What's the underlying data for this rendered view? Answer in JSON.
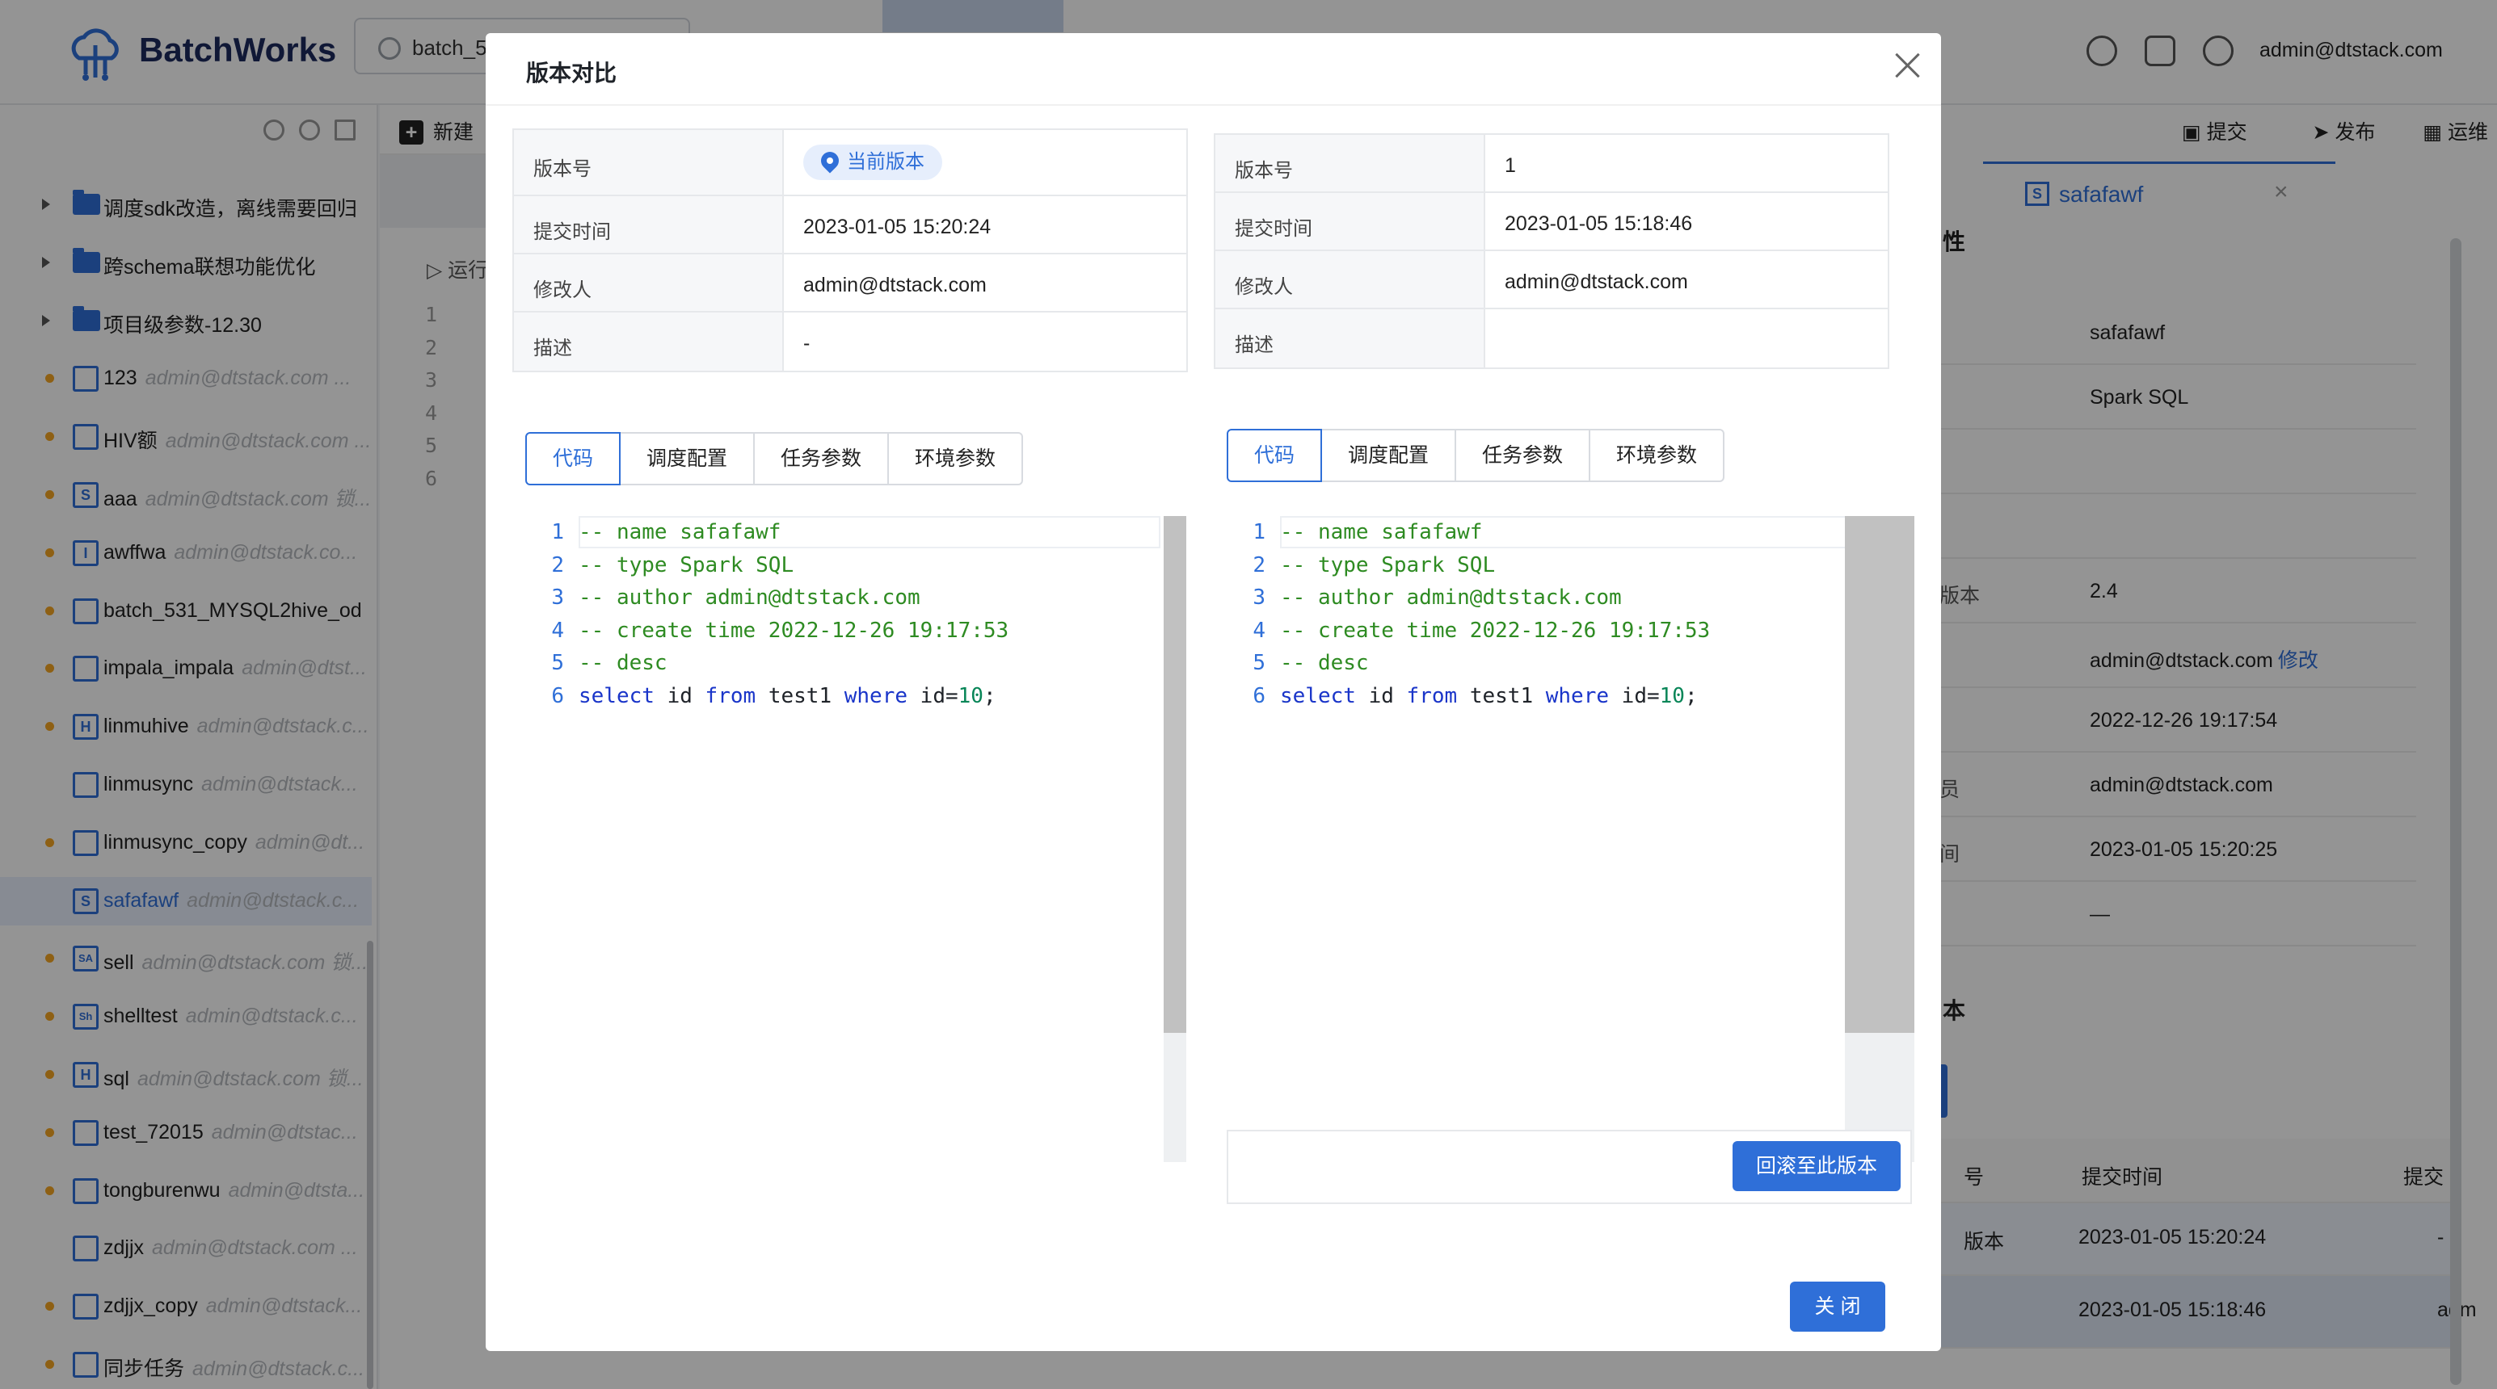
{
  "app": {
    "brand": "BatchWorks",
    "open_tab": "batch_5",
    "user": "admin@dtstack.com",
    "accent_color": "#2f6fd8"
  },
  "header_icons": [
    "help-icon",
    "message-icon",
    "settings-icon"
  ],
  "toolbar": {
    "new_label": "新建",
    "submit_label": "提交",
    "publish_label": "发布",
    "ops_label": "运维"
  },
  "sidebar": {
    "items": [
      {
        "type": "folder",
        "name": "调度sdk改造，离线需要回归",
        "owner": ""
      },
      {
        "type": "folder",
        "name": "跨schema联想功能优化",
        "owner": ""
      },
      {
        "type": "folder",
        "name": "项目级参数-12.30",
        "owner": ""
      },
      {
        "type": "task",
        "icon": "sync-task-icon",
        "badge": "",
        "name": "123",
        "owner": "admin@dtstack.com ..."
      },
      {
        "type": "task",
        "icon": "sync-task-icon",
        "badge": "",
        "name": "HIV额",
        "owner": "admin@dtstack.com ..."
      },
      {
        "type": "task",
        "icon": "spark-sql-icon",
        "badge": "S",
        "name": "aaa",
        "owner": "admin@dtstack.com 锁..."
      },
      {
        "type": "task",
        "icon": "impala-icon",
        "badge": "I",
        "name": "awffwa",
        "owner": "admin@dtstack.co..."
      },
      {
        "type": "task",
        "icon": "sync-task-icon",
        "badge": "",
        "name": "batch_531_MYSQL2hive_od",
        "owner": ""
      },
      {
        "type": "task",
        "icon": "sync-task-icon",
        "badge": "",
        "name": "impala_impala",
        "owner": "admin@dtst..."
      },
      {
        "type": "task",
        "icon": "hive-sql-icon",
        "badge": "H",
        "name": "linmuhive",
        "owner": "admin@dtstack.c..."
      },
      {
        "type": "task",
        "icon": "sync-task-icon",
        "badge": "",
        "name": "linmusync",
        "owner": "admin@dtstack..."
      },
      {
        "type": "task",
        "icon": "sync-task-icon",
        "badge": "",
        "name": "linmusync_copy",
        "owner": "admin@dt..."
      },
      {
        "type": "task",
        "icon": "spark-sql-icon",
        "badge": "S",
        "name": "safafawf",
        "owner": "admin@dtstack.c...",
        "selected": true
      },
      {
        "type": "task",
        "icon": "spark-icon",
        "badge": "SA",
        "name": "sell",
        "owner": "admin@dtstack.com 锁..."
      },
      {
        "type": "task",
        "icon": "shell-icon",
        "badge": "Sh",
        "name": "shelltest",
        "owner": "admin@dtstack.c..."
      },
      {
        "type": "task",
        "icon": "hive-sql-icon",
        "badge": "H",
        "name": "sql",
        "owner": "admin@dtstack.com 锁..."
      },
      {
        "type": "task",
        "icon": "sync-task-icon",
        "badge": "",
        "name": "test_72015",
        "owner": "admin@dtstac..."
      },
      {
        "type": "task",
        "icon": "sync-task-icon",
        "badge": "",
        "name": "tongburenwu",
        "owner": "admin@dtsta..."
      },
      {
        "type": "task",
        "icon": "sync-task-icon",
        "badge": "",
        "name": "zdjjx",
        "owner": "admin@dtstack.com ..."
      },
      {
        "type": "task",
        "icon": "sync-task-icon",
        "badge": "",
        "name": "zdjjx_copy",
        "owner": "admin@dtstack..."
      },
      {
        "type": "task",
        "icon": "sync-task-icon",
        "badge": "",
        "name": "同步任务",
        "owner": "admin@dtstack.c..."
      }
    ]
  },
  "editor": {
    "run_label": "运行",
    "gutter": [
      "1",
      "2",
      "3",
      "4",
      "5",
      "6"
    ]
  },
  "right_panel": {
    "tab_label": "safafawf",
    "tab_badge": "S",
    "section_title": "性",
    "props": [
      {
        "k": "",
        "v": "safafawf"
      },
      {
        "k": "",
        "v": "Spark SQL"
      },
      {
        "k": "",
        "v": ""
      },
      {
        "k": "",
        "v": ""
      },
      {
        "k": "版本",
        "v": "2.4"
      },
      {
        "k": "",
        "v": "admin@dtstack.com",
        "link": "修改"
      },
      {
        "k": "",
        "v": "2022-12-26 19:17:54"
      },
      {
        "k": "员",
        "v": "admin@dtstack.com"
      },
      {
        "k": "间",
        "v": "2023-01-05 15:20:25"
      },
      {
        "k": "",
        "v": "—"
      }
    ],
    "version_title": "本",
    "table_header": {
      "c1": "号",
      "c2": "提交时间",
      "c3": "提交"
    },
    "table_rows": [
      {
        "c1": "版本",
        "c2": "2023-01-05 15:20:24",
        "c3": "-"
      },
      {
        "c1": "",
        "c2": "2023-01-05 15:18:46",
        "c3": "adm"
      }
    ]
  },
  "modal": {
    "title": "版本对比",
    "close_label": "关 闭",
    "rollback_label": "回滚至此版本",
    "tabs": [
      "代码",
      "调度配置",
      "任务参数",
      "环境参数"
    ],
    "labels": {
      "version": "版本号",
      "submit_time": "提交时间",
      "modifier": "修改人",
      "desc": "描述"
    },
    "left": {
      "version": "当前版本",
      "submit_time": "2023-01-05 15:20:24",
      "modifier": "admin@dtstack.com",
      "desc": "-"
    },
    "right": {
      "version": "1",
      "submit_time": "2023-01-05 15:18:46",
      "modifier": "admin@dtstack.com",
      "desc": ""
    },
    "code_lines": [
      "-- name safafawf",
      "-- type Spark SQL",
      "-- author admin@dtstack.com",
      "-- create time 2022-12-26 19:17:53",
      "-- desc",
      "select id from test1 where id=10;"
    ]
  }
}
